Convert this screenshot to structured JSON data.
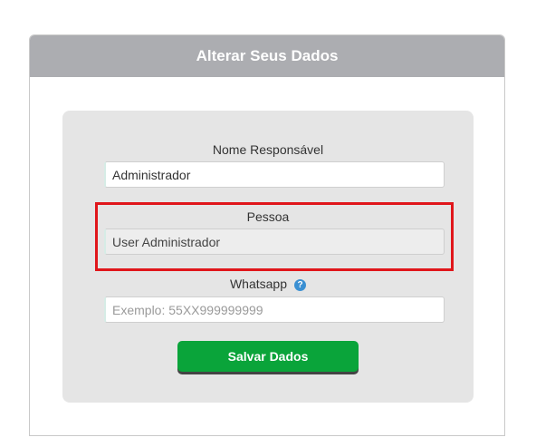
{
  "panel": {
    "title": "Alterar Seus Dados"
  },
  "form": {
    "responsavel": {
      "label": "Nome Responsável",
      "value": "Administrador"
    },
    "pessoa": {
      "label": "Pessoa",
      "value": "User Administrador"
    },
    "whatsapp": {
      "label": "Whatsapp",
      "placeholder": "Exemplo: 55XX999999999",
      "help_icon": "question-circle-icon",
      "help_glyph": "?"
    },
    "save_label": "Salvar Dados"
  },
  "colors": {
    "header_bg": "#acadb1",
    "form_bg": "#e5e5e5",
    "save_button": "#0aa43a",
    "highlight_border": "#e0161b",
    "help_icon": "#3a8fd2"
  }
}
